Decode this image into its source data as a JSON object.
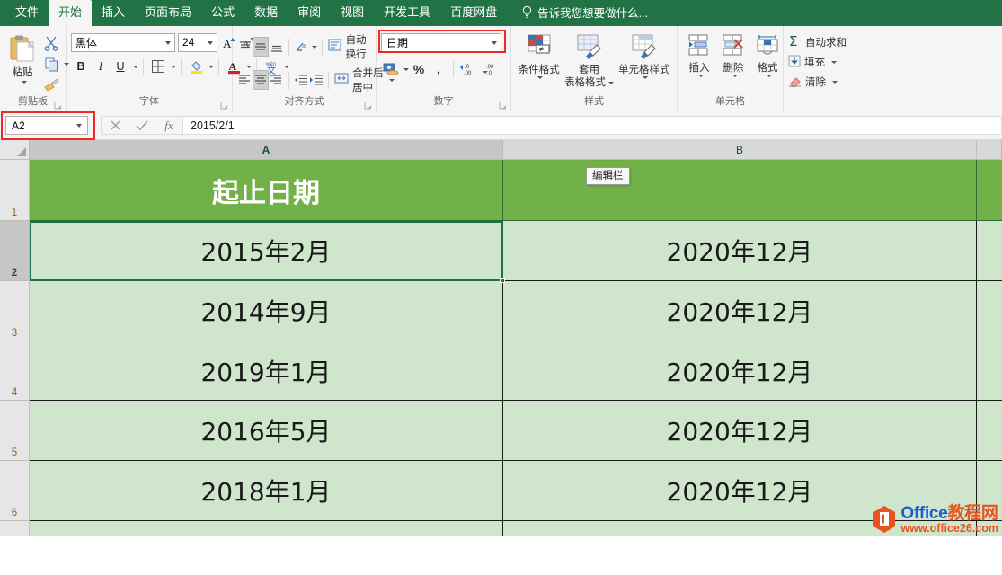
{
  "tabs": [
    {
      "label": "文件",
      "active": false,
      "name": "tab-file"
    },
    {
      "label": "开始",
      "active": true,
      "name": "tab-home"
    },
    {
      "label": "插入",
      "active": false,
      "name": "tab-insert"
    },
    {
      "label": "页面布局",
      "active": false,
      "name": "tab-page-layout"
    },
    {
      "label": "公式",
      "active": false,
      "name": "tab-formulas"
    },
    {
      "label": "数据",
      "active": false,
      "name": "tab-data"
    },
    {
      "label": "审阅",
      "active": false,
      "name": "tab-review"
    },
    {
      "label": "视图",
      "active": false,
      "name": "tab-view"
    },
    {
      "label": "开发工具",
      "active": false,
      "name": "tab-developer"
    },
    {
      "label": "百度网盘",
      "active": false,
      "name": "tab-baidu-netdisk"
    }
  ],
  "tell_me": "告诉我您想要做什么...",
  "ribbon": {
    "clipboard": {
      "paste_label": "粘贴",
      "group_label": "剪贴板",
      "cut_name": "cut-icon",
      "copy_name": "copy-icon",
      "format_painter_name": "format-painter-icon"
    },
    "font": {
      "font_name": "黑体",
      "font_size": "24",
      "bold": "B",
      "italic": "I",
      "underline": "U",
      "group_label": "字体",
      "grow_font": "A",
      "shrink_font": "A"
    },
    "alignment": {
      "wrap_text": "自动换行",
      "merge_center": "合并后居中",
      "group_label": "对齐方式"
    },
    "number": {
      "format_value": "日期",
      "percent": "%",
      "comma": ",",
      "group_label": "数字",
      "highlight_color": "#ef2828"
    },
    "styles": {
      "conditional": "条件格式",
      "table_format_l1": "套用",
      "table_format_l2": "表格格式",
      "cell_styles": "单元格样式",
      "group_label": "样式"
    },
    "cells": {
      "insert": "插入",
      "delete": "删除",
      "format": "格式",
      "group_label": "单元格"
    },
    "editing": {
      "autosum": "自动求和",
      "fill": "填充",
      "clear": "清除"
    }
  },
  "formula_bar": {
    "name_box": "A2",
    "name_box_highlight": "#ef2828",
    "cancel_icon": "close-icon",
    "accept_icon": "check-icon",
    "fx_icon": "fx-icon",
    "value": "2015/2/1"
  },
  "tooltip": {
    "text": "编辑栏"
  },
  "sheet": {
    "columns": [
      {
        "label": "A",
        "selected": true
      },
      {
        "label": "B",
        "selected": false
      },
      {
        "label": "",
        "selected": false
      }
    ],
    "rows": [
      {
        "num": "1",
        "selected": false,
        "header_row": true,
        "cells": [
          "起止日期",
          "",
          ""
        ]
      },
      {
        "num": "2",
        "selected": true,
        "header_row": false,
        "cells": [
          "2015年2月",
          "2020年12月",
          ""
        ]
      },
      {
        "num": "3",
        "selected": false,
        "header_row": false,
        "cells": [
          "2014年9月",
          "2020年12月",
          ""
        ]
      },
      {
        "num": "4",
        "selected": false,
        "header_row": false,
        "cells": [
          "2019年1月",
          "2020年12月",
          ""
        ]
      },
      {
        "num": "5",
        "selected": false,
        "header_row": false,
        "cells": [
          "2016年5月",
          "2020年12月",
          ""
        ]
      },
      {
        "num": "6",
        "selected": false,
        "header_row": false,
        "cells": [
          "2018年1月",
          "2020年12月",
          ""
        ]
      },
      {
        "num": "",
        "selected": false,
        "header_row": false,
        "cells": [
          "",
          "",
          ""
        ]
      }
    ],
    "header_fill": "#72b048",
    "cell_fill": "#cfe5cc",
    "selection_color": "#1e7145"
  },
  "watermark": {
    "brand_en": "Office",
    "brand_cn": "教程网",
    "url": "www.office26.com"
  }
}
